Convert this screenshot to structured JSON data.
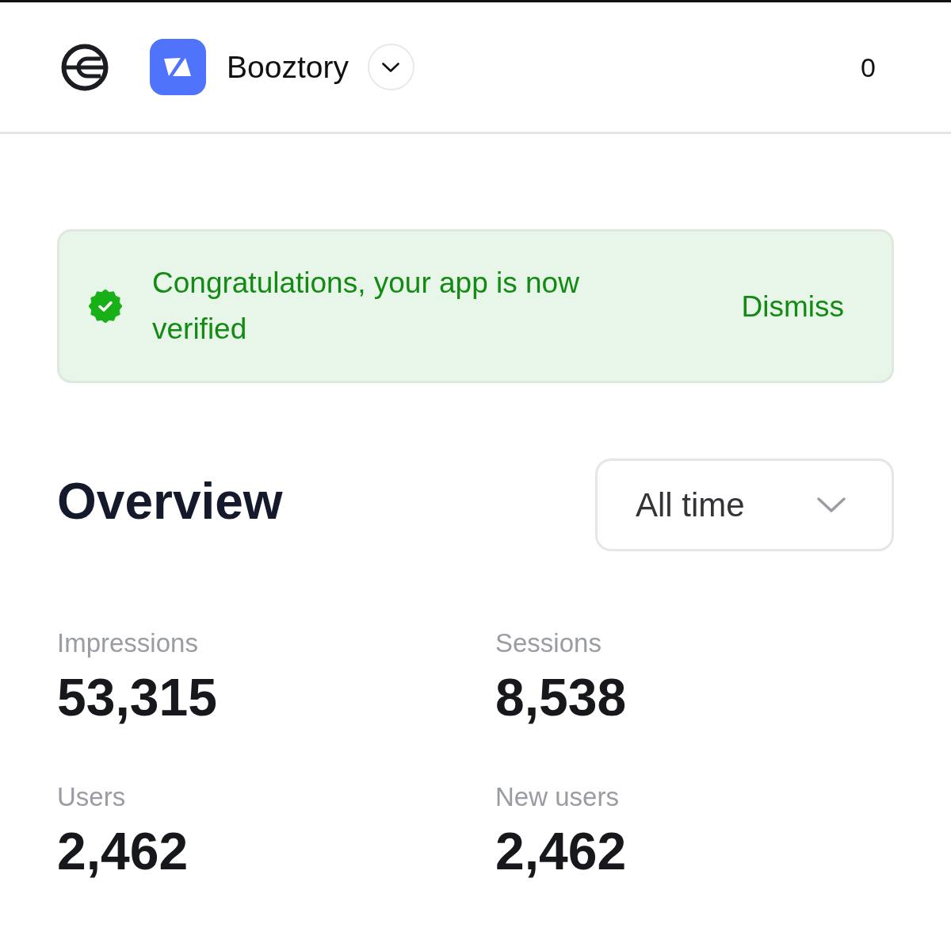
{
  "header": {
    "app": {
      "name": "Booztory"
    },
    "counter": "0"
  },
  "banner": {
    "message": "Congratulations, your app is now verified",
    "action": "Dismiss"
  },
  "overview": {
    "title": "Overview",
    "range": {
      "value": "All time"
    }
  },
  "stats": [
    {
      "label": "Impressions",
      "value": "53,315"
    },
    {
      "label": "Sessions",
      "value": "8,538"
    },
    {
      "label": "Users",
      "value": "2,462"
    },
    {
      "label": "New users",
      "value": "2,462"
    }
  ]
}
